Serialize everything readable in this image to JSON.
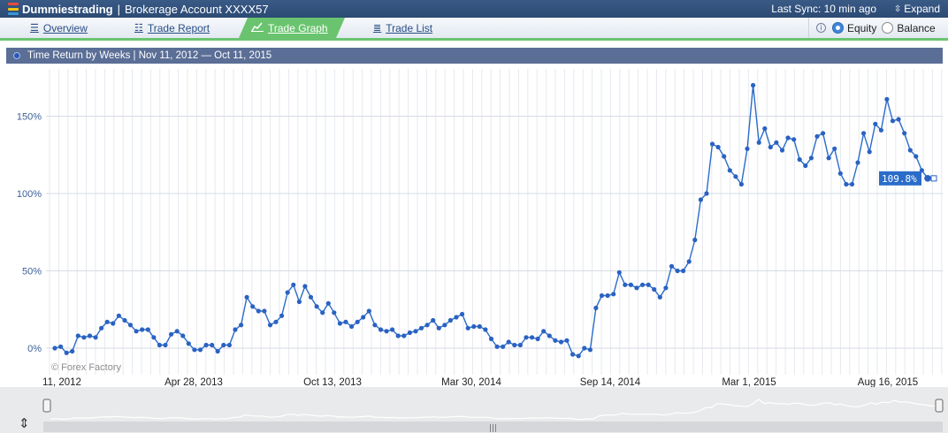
{
  "header": {
    "brand": "Dummiestrading",
    "separator": "|",
    "account": "Brokerage Account XXXX57",
    "last_sync": "Last Sync: 10 min ago",
    "expand_label": "Expand",
    "logo_colors": [
      "#e74c3c",
      "#f1c40f",
      "#3498db"
    ]
  },
  "tabs": [
    {
      "label": "Overview",
      "icon": "overview-icon",
      "active": false
    },
    {
      "label": "Trade Report",
      "icon": "trade-report-icon",
      "active": false
    },
    {
      "label": "Trade Graph",
      "icon": "trade-graph-icon",
      "active": true
    },
    {
      "label": "Trade List",
      "icon": "trade-list-icon",
      "active": false
    }
  ],
  "options": {
    "equity_label": "Equity",
    "balance_label": "Balance",
    "selected": "Equity"
  },
  "panel": {
    "title": "Time Return by Weeks | Nov 11, 2012 — Oct 11, 2015"
  },
  "chart_data": {
    "type": "line",
    "x_labels": [
      "11, 2012",
      "Apr 28, 2013",
      "Oct 13, 2013",
      "Mar 30, 2014",
      "Sep 14, 2014",
      "Mar 1, 2015",
      "Aug 16, 2015"
    ],
    "y_ticks": [
      "0%",
      "50%",
      "100%",
      "150%"
    ],
    "ylim": [
      -12,
      172
    ],
    "last_value_label": "109.8%",
    "watermark": "© Forex Factory",
    "line_color": "#2a6cc9",
    "grid": true,
    "series": [
      {
        "values": [
          0,
          1,
          -3,
          -2,
          8,
          7,
          8,
          7,
          13,
          17,
          16,
          21,
          18,
          15,
          11,
          12,
          12,
          7,
          2,
          2,
          9,
          11,
          8,
          3,
          -1,
          -1,
          2,
          2,
          -2,
          2,
          2,
          12,
          15,
          33,
          27,
          24,
          24,
          15,
          17,
          21,
          36,
          41,
          30,
          40,
          33,
          27,
          23,
          29,
          23,
          16,
          17,
          14,
          17,
          20,
          24,
          15,
          12,
          11,
          12,
          8,
          8,
          10,
          11,
          13,
          15,
          18,
          13,
          15,
          18,
          20,
          22,
          13,
          14,
          14,
          12,
          6,
          1,
          1,
          4,
          2,
          2,
          7,
          7,
          6,
          11,
          8,
          5,
          4,
          5,
          -4,
          -5,
          0,
          -1,
          26,
          34,
          34,
          35,
          49,
          41,
          41,
          39,
          41,
          41,
          38,
          33,
          39,
          53,
          50,
          50,
          56,
          70,
          96,
          100,
          132,
          130,
          124,
          115,
          111,
          106,
          129,
          170,
          133,
          142,
          130,
          133,
          128,
          136,
          135,
          122,
          118,
          123,
          137,
          139,
          123,
          129,
          113,
          106,
          106,
          120,
          139,
          127,
          145,
          141,
          161,
          147,
          148,
          139,
          128,
          124,
          115,
          109.8
        ]
      }
    ]
  },
  "scrollbar": {
    "handle_icon": "grip-icon"
  }
}
